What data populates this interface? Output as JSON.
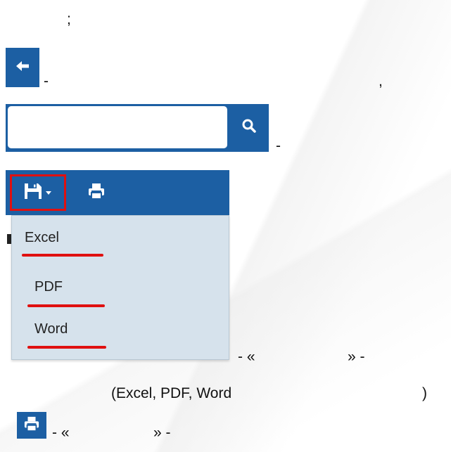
{
  "colors": {
    "accent": "#1c5fa3",
    "highlight": "#e01010",
    "menu_bg": "#d6e2ec"
  },
  "fragments": {
    "line1": ";",
    "after_back": "-",
    "comma": ",",
    "after_search": "-",
    "after_dropdown_open": "- «",
    "after_dropdown_close": "» -",
    "formats_line": "(Excel, PDF, Word",
    "formats_close": ")",
    "print_open": "- «",
    "print_close": "» -"
  },
  "icons": {
    "back": "arrow-left-icon",
    "search": "search-icon",
    "save": "floppy-disk-icon",
    "caret": "caret-down-icon",
    "print": "printer-icon"
  },
  "search": {
    "value": "",
    "placeholder": ""
  },
  "export_menu": {
    "items": [
      {
        "label": "Excel"
      },
      {
        "label": "PDF"
      },
      {
        "label": "Word"
      }
    ]
  }
}
